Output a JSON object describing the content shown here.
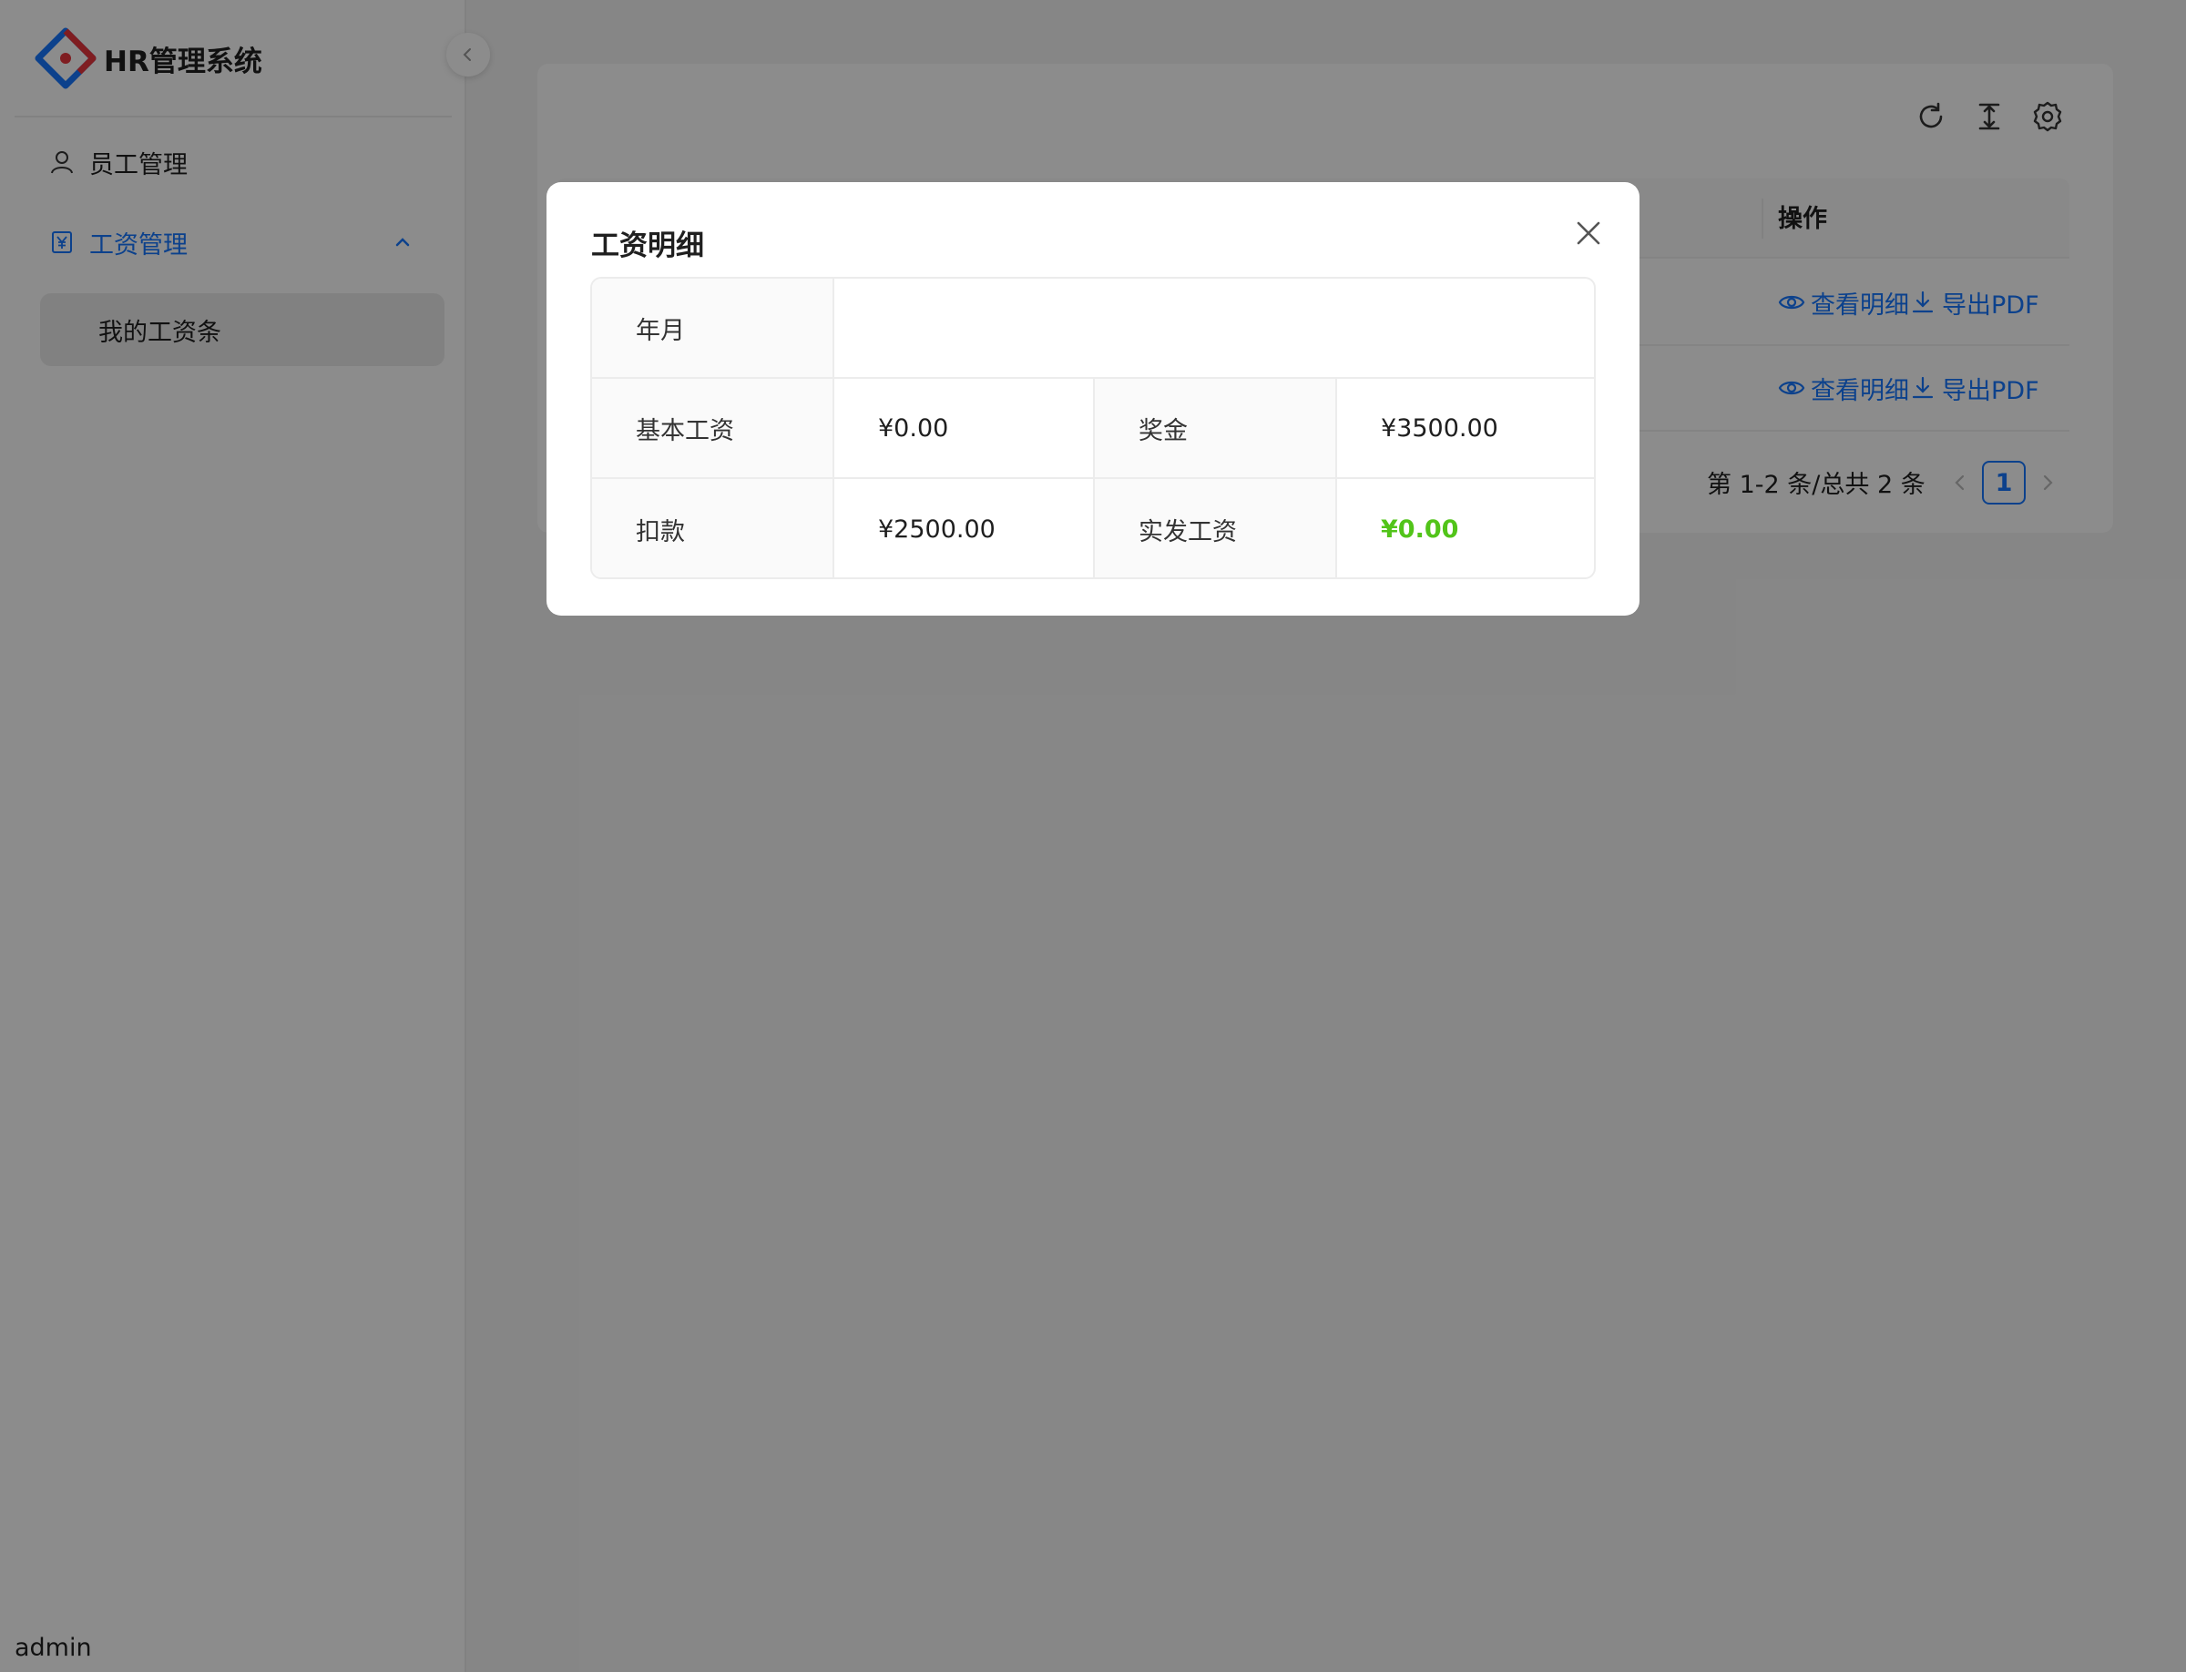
{
  "brand": {
    "title": "HR管理系统"
  },
  "sidebar": {
    "items": [
      {
        "label": "员工管理",
        "icon": "user-icon"
      },
      {
        "label": "工资管理",
        "icon": "salary-icon",
        "expanded": true,
        "children": [
          {
            "label": "我的工资条",
            "selected": true
          }
        ]
      }
    ]
  },
  "user": {
    "name": "admin"
  },
  "toolbar": {
    "icons": [
      "reload-icon",
      "column-height-icon",
      "settings-icon"
    ]
  },
  "table": {
    "ops_header": "操作",
    "rows": [
      {
        "view_label": "查看明细",
        "export_label": "导出PDF"
      },
      {
        "view_label": "查看明细",
        "export_label": "导出PDF"
      }
    ]
  },
  "pagination": {
    "total_text": "第 1-2 条/总共 2 条",
    "current_page": "1"
  },
  "modal": {
    "title": "工资明细",
    "fields": {
      "year_month_label": "年月",
      "year_month_value": "",
      "base_salary_label": "基本工资",
      "base_salary_value": "¥0.00",
      "bonus_label": "奖金",
      "bonus_value": "¥3500.00",
      "deduction_label": "扣款",
      "deduction_value": "¥2500.00",
      "net_pay_label": "实发工资",
      "net_pay_value": "¥0.00"
    }
  },
  "colors": {
    "primary": "#1677ff",
    "success": "#52c41a",
    "mask": "rgba(0,0,0,0.45)"
  }
}
